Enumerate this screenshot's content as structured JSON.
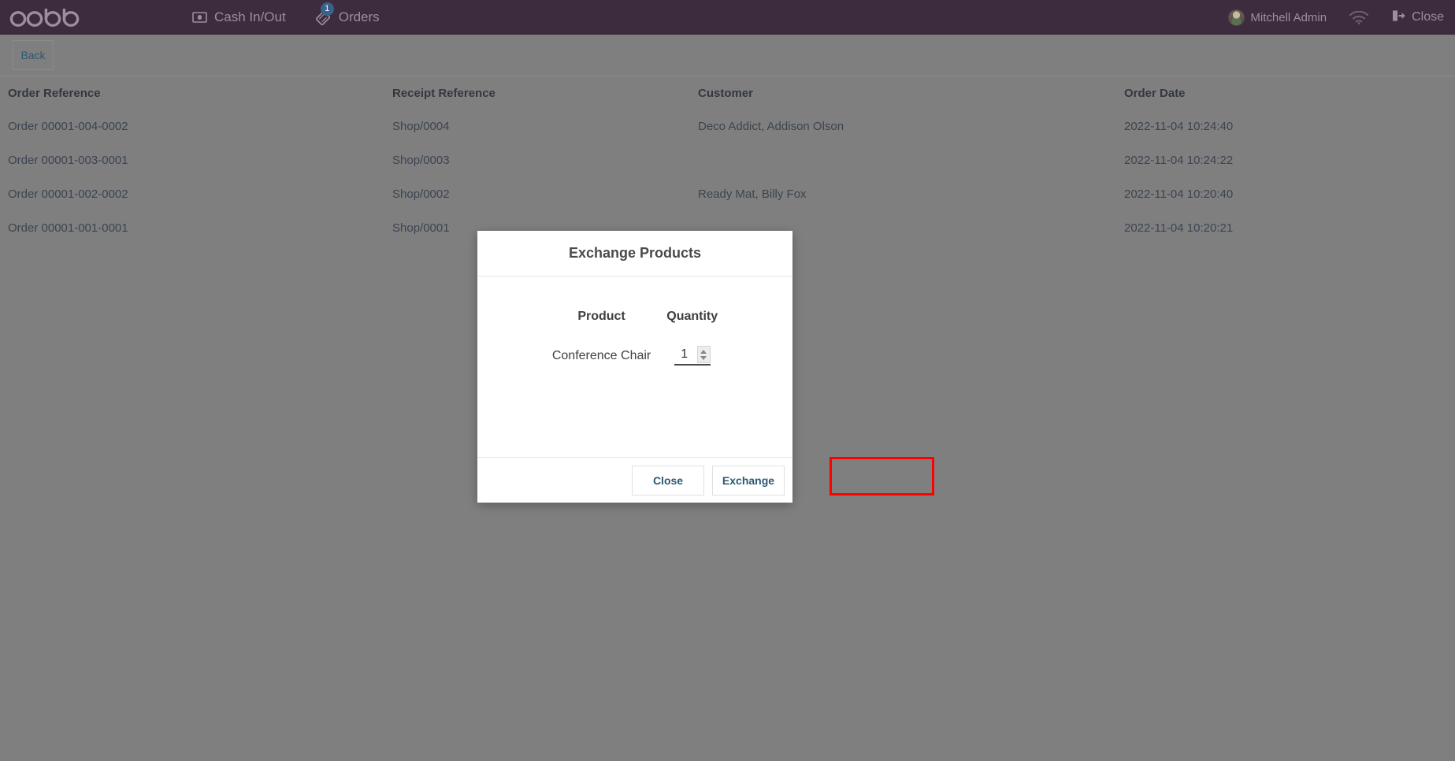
{
  "navbar": {
    "brand": "odoo",
    "items": [
      {
        "label": "Cash In/Out",
        "icon": "banknote-icon",
        "badge": null
      },
      {
        "label": "Orders",
        "icon": "tag-icon",
        "badge": "1"
      }
    ],
    "user": "Mitchell Admin",
    "wifi_icon": "wifi-icon",
    "close_label": "Close",
    "close_icon": "logout-icon"
  },
  "subbar": {
    "back_label": "Back"
  },
  "table": {
    "columns": [
      "Order Reference",
      "Receipt Reference",
      "Customer",
      "Order Date"
    ],
    "rows": [
      {
        "order": "Order 00001-004-0002",
        "receipt": "Shop/0004",
        "customer": "Deco Addict, Addison Olson",
        "date": "2022-11-04 10:24:40"
      },
      {
        "order": "Order 00001-003-0001",
        "receipt": "Shop/0003",
        "customer": "",
        "date": "2022-11-04 10:24:22"
      },
      {
        "order": "Order 00001-002-0002",
        "receipt": "Shop/0002",
        "customer": "Ready Mat, Billy Fox",
        "date": "2022-11-04 10:20:40"
      },
      {
        "order": "Order 00001-001-0001",
        "receipt": "Shop/0001",
        "customer": "",
        "date": "2022-11-04 10:20:21"
      }
    ]
  },
  "modal": {
    "title": "Exchange Products",
    "columns": {
      "product": "Product",
      "quantity": "Quantity"
    },
    "lines": [
      {
        "product": "Conference Chair",
        "quantity": "1"
      }
    ],
    "close_label": "Close",
    "exchange_label": "Exchange"
  },
  "colors": {
    "navbar_bg": "#3c2c3e",
    "page_overlay": "#7f7f7f",
    "link": "#2d5871",
    "badge": "#39628a",
    "highlight": "#ff0000"
  }
}
